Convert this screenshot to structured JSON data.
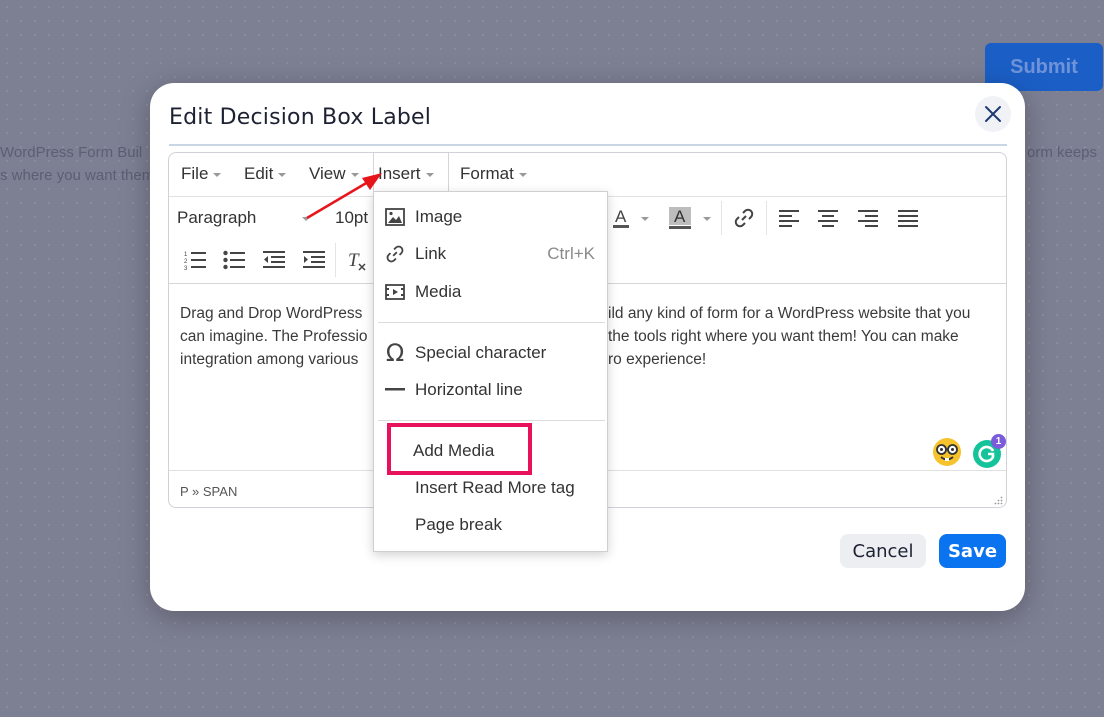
{
  "background": {
    "text_left_line1": "WordPress Form Buil",
    "text_left_line2": "s where you want them",
    "text_right": "orm keeps",
    "submit_label": "Submit"
  },
  "modal": {
    "title": "Edit Decision Box Label",
    "cancel_label": "Cancel",
    "save_label": "Save"
  },
  "menubar": {
    "file": "File",
    "edit": "Edit",
    "view": "View",
    "insert": "Insert",
    "format": "Format"
  },
  "toolbar": {
    "block_format": "Paragraph",
    "font_size": "10pt"
  },
  "content": {
    "line1_left": "Drag and Drop WordPress",
    "line1_right": "ild any kind of form for a WordPress website that you",
    "line2_left": "can imagine. The Professio",
    "line2_right": "the tools right where you want them! You can make",
    "line3_left": "integration among various",
    "line3_right": "ro experience!"
  },
  "statusbar": {
    "path": "P » SPAN"
  },
  "insert_menu": {
    "items": [
      {
        "label": "Image",
        "icon": "image-icon"
      },
      {
        "label": "Link",
        "icon": "link-icon",
        "shortcut": "Ctrl+K"
      },
      {
        "label": "Media",
        "icon": "media-icon"
      },
      {
        "label": "Special character",
        "icon": "omega-icon"
      },
      {
        "label": "Horizontal line",
        "icon": "horizontal-line-icon"
      },
      {
        "label": "Add Media"
      },
      {
        "label": "Insert Read More tag"
      },
      {
        "label": "Page break"
      }
    ]
  },
  "grammarly_badge": "1",
  "colors": {
    "accent": "#0a73f0",
    "highlight": "#e8125c",
    "arrow": "#e8141c"
  }
}
